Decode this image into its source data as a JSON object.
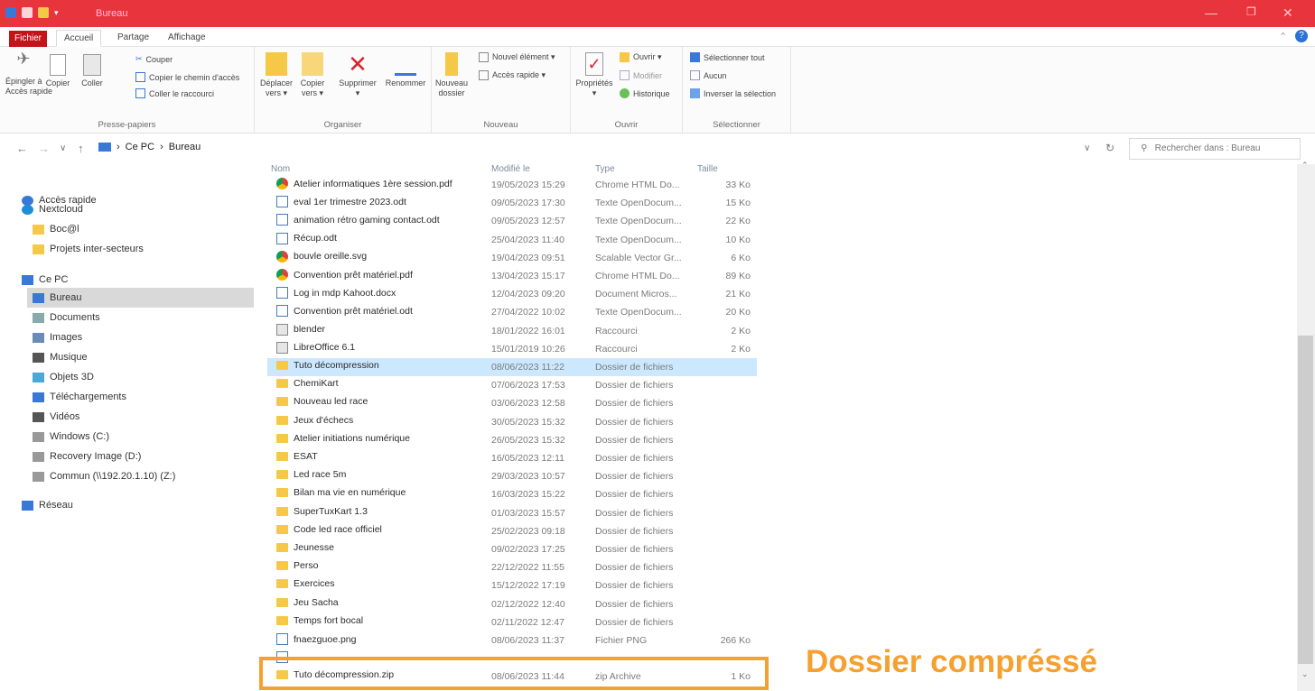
{
  "window": {
    "title": "Bureau"
  },
  "ribbon_tabs": [
    "Fichier",
    "Accueil",
    "Partage",
    "Affichage"
  ],
  "ribbon": {
    "presse": {
      "label": "Presse-papiers",
      "pin": "Épingler à\nAccès rapide",
      "copy": "Copier",
      "paste": "Coller",
      "cut": "Couper",
      "copy_path": "Copier le chemin d'accès",
      "paste_shortcut": "Coller le raccourci"
    },
    "organiser": {
      "label": "Organiser",
      "move": "Déplacer\nvers ▾",
      "copy_to": "Copier\nvers ▾",
      "delete": "Supprimer\n▾",
      "rename": "Renommer"
    },
    "nouveau": {
      "label": "Nouveau",
      "new_folder": "Nouveau\ndossier",
      "new_item": "Nouvel élément ▾",
      "quick_access": "Accès rapide ▾"
    },
    "ouvrir": {
      "label": "Ouvrir",
      "properties": "Propriétés\n▾",
      "open": "Ouvrir ▾",
      "edit": "Modifier",
      "history": "Historique"
    },
    "selectionner": {
      "label": "Sélectionner",
      "select_all": "Sélectionner tout",
      "none": "Aucun",
      "invert": "Inverser la sélection"
    }
  },
  "address": {
    "crumbs": [
      "Ce PC",
      "Bureau"
    ],
    "search_placeholder": "Rechercher dans : Bureau"
  },
  "sidebar": [
    {
      "label": "Accès rapide",
      "icon": "star-icon"
    },
    {
      "label": "Nextcloud",
      "icon": "cloud-icon"
    },
    {
      "label": "Boc@l",
      "icon": "folder-icon"
    },
    {
      "label": "Projets inter-secteurs",
      "icon": "folder-icon"
    },
    {
      "label": "Ce PC",
      "icon": "computer-icon"
    },
    {
      "label": "Bureau",
      "icon": "desktop-icon"
    },
    {
      "label": "Documents",
      "icon": "documents-icon"
    },
    {
      "label": "Images",
      "icon": "images-icon"
    },
    {
      "label": "Musique",
      "icon": "music-icon"
    },
    {
      "label": "Objets 3D",
      "icon": "3d-objects-icon"
    },
    {
      "label": "Téléchargements",
      "icon": "download-icon"
    },
    {
      "label": "Vidéos",
      "icon": "video-icon"
    },
    {
      "label": "Windows (C:)",
      "icon": "drive-icon"
    },
    {
      "label": "Recovery Image (D:)",
      "icon": "drive-icon"
    },
    {
      "label": "Commun (\\\\192.20.1.10) (Z:)",
      "icon": "network-drive-icon"
    },
    {
      "label": "Réseau",
      "icon": "network-icon"
    }
  ],
  "columns": {
    "name": "Nom",
    "modified": "Modifié le",
    "type": "Type",
    "size": "Taille"
  },
  "files": [
    {
      "name": "Atelier informatiques 1ère session.pdf",
      "date": "19/05/2023 15:29",
      "type": "Chrome HTML Do...",
      "size": "33 Ko",
      "icon": "chrome"
    },
    {
      "name": "eval 1er trimestre 2023.odt",
      "date": "09/05/2023 17:30",
      "type": "Texte OpenDocum...",
      "size": "15 Ko",
      "icon": "doc"
    },
    {
      "name": "animation rétro gaming contact.odt",
      "date": "09/05/2023 12:57",
      "type": "Texte OpenDocum...",
      "size": "22 Ko",
      "icon": "doc"
    },
    {
      "name": "Récup.odt",
      "date": "25/04/2023 11:40",
      "type": "Texte OpenDocum...",
      "size": "10 Ko",
      "icon": "doc"
    },
    {
      "name": "bouvle oreille.svg",
      "date": "19/04/2023 09:51",
      "type": "Scalable Vector Gr...",
      "size": "6 Ko",
      "icon": "svg"
    },
    {
      "name": "Convention prêt matériel.pdf",
      "date": "13/04/2023 15:17",
      "type": "Chrome HTML Do...",
      "size": "89 Ko",
      "icon": "chrome"
    },
    {
      "name": "Log in mdp Kahoot.docx",
      "date": "12/04/2023 09:20",
      "type": "Document Micros...",
      "size": "21 Ko",
      "icon": "doc"
    },
    {
      "name": "Convention prêt matériel.odt",
      "date": "27/04/2022 10:02",
      "type": "Texte OpenDocum...",
      "size": "20 Ko",
      "icon": "doc"
    },
    {
      "name": "blender",
      "date": "18/01/2022 16:01",
      "type": "Raccourci",
      "size": "2 Ko",
      "icon": "shortcut"
    },
    {
      "name": "LibreOffice 6.1",
      "date": "15/01/2019 10:26",
      "type": "Raccourci",
      "size": "2 Ko",
      "icon": "shortcut"
    },
    {
      "name": "Tuto décompression",
      "date": "08/06/2023 11:22",
      "type": "Dossier de fichiers",
      "size": "",
      "icon": "folder",
      "selected": true
    },
    {
      "name": "ChemiKart",
      "date": "07/06/2023 17:53",
      "type": "Dossier de fichiers",
      "size": "",
      "icon": "folder"
    },
    {
      "name": "Nouveau led race",
      "date": "03/06/2023 12:58",
      "type": "Dossier de fichiers",
      "size": "",
      "icon": "folder"
    },
    {
      "name": "Jeux d'échecs",
      "date": "30/05/2023 15:32",
      "type": "Dossier de fichiers",
      "size": "",
      "icon": "folder"
    },
    {
      "name": "Atelier initiations numérique",
      "date": "26/05/2023 15:32",
      "type": "Dossier de fichiers",
      "size": "",
      "icon": "folder"
    },
    {
      "name": "ESAT",
      "date": "16/05/2023 12:11",
      "type": "Dossier de fichiers",
      "size": "",
      "icon": "folder"
    },
    {
      "name": "Led race 5m",
      "date": "29/03/2023 10:57",
      "type": "Dossier de fichiers",
      "size": "",
      "icon": "folder"
    },
    {
      "name": "Bilan ma vie en numérique",
      "date": "16/03/2023 15:22",
      "type": "Dossier de fichiers",
      "size": "",
      "icon": "folder"
    },
    {
      "name": "SuperTuxKart 1.3",
      "date": "01/03/2023 15:57",
      "type": "Dossier de fichiers",
      "size": "",
      "icon": "folder"
    },
    {
      "name": "Code led race officiel",
      "date": "25/02/2023 09:18",
      "type": "Dossier de fichiers",
      "size": "",
      "icon": "folder"
    },
    {
      "name": "Jeunesse",
      "date": "09/02/2023 17:25",
      "type": "Dossier de fichiers",
      "size": "",
      "icon": "folder"
    },
    {
      "name": "Perso",
      "date": "22/12/2022 11:55",
      "type": "Dossier de fichiers",
      "size": "",
      "icon": "folder"
    },
    {
      "name": "Exercices",
      "date": "15/12/2022 17:19",
      "type": "Dossier de fichiers",
      "size": "",
      "icon": "folder"
    },
    {
      "name": "Jeu Sacha",
      "date": "02/12/2022 12:40",
      "type": "Dossier de fichiers",
      "size": "",
      "icon": "folder"
    },
    {
      "name": "Temps fort bocal",
      "date": "02/11/2022 12:47",
      "type": "Dossier de fichiers",
      "size": "",
      "icon": "folder"
    },
    {
      "name": "fnaezguoe.png",
      "date": "08/06/2023 11:37",
      "type": "Fichier PNG",
      "size": "266 Ko",
      "icon": "png"
    },
    {
      "name": "",
      "date": "",
      "type": "",
      "size": "",
      "icon": "png"
    },
    {
      "name": "Tuto décompression.zip",
      "date": "08/06/2023 11:44",
      "type": "zip Archive",
      "size": "1 Ko",
      "icon": "zip"
    }
  ],
  "annotation": {
    "text": "Dossier compréssé",
    "color": "#f5a030"
  }
}
